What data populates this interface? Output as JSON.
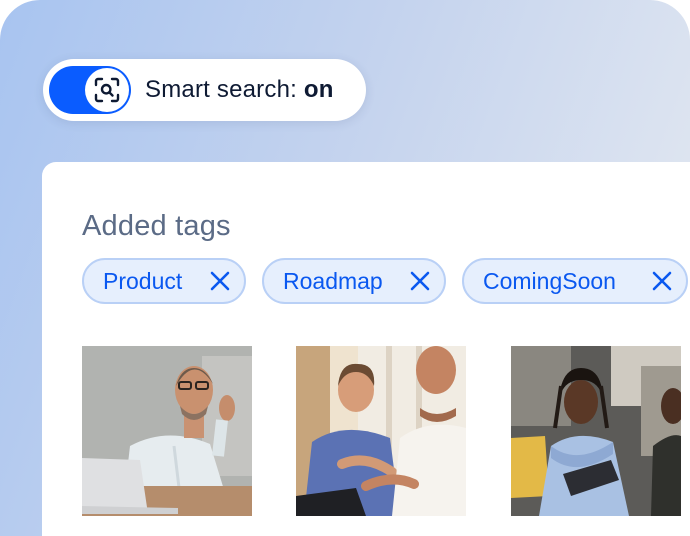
{
  "smart_search": {
    "label_prefix": "Smart search:",
    "state": "on",
    "toggle_icon": "scan-search-icon",
    "accent_color": "#0a5cff"
  },
  "tags_section": {
    "title": "Added tags",
    "tags": [
      {
        "label": "Product",
        "remove_icon": "close-icon"
      },
      {
        "label": "Roadmap",
        "remove_icon": "close-icon"
      },
      {
        "label": "ComingSoon",
        "remove_icon": "close-icon"
      }
    ],
    "tag_color": "#0a58f0"
  },
  "photos": [
    {
      "subject": "man-with-glasses-at-laptop"
    },
    {
      "subject": "two-men-in-conversation"
    },
    {
      "subject": "woman-with-tablet-in-meeting"
    }
  ]
}
